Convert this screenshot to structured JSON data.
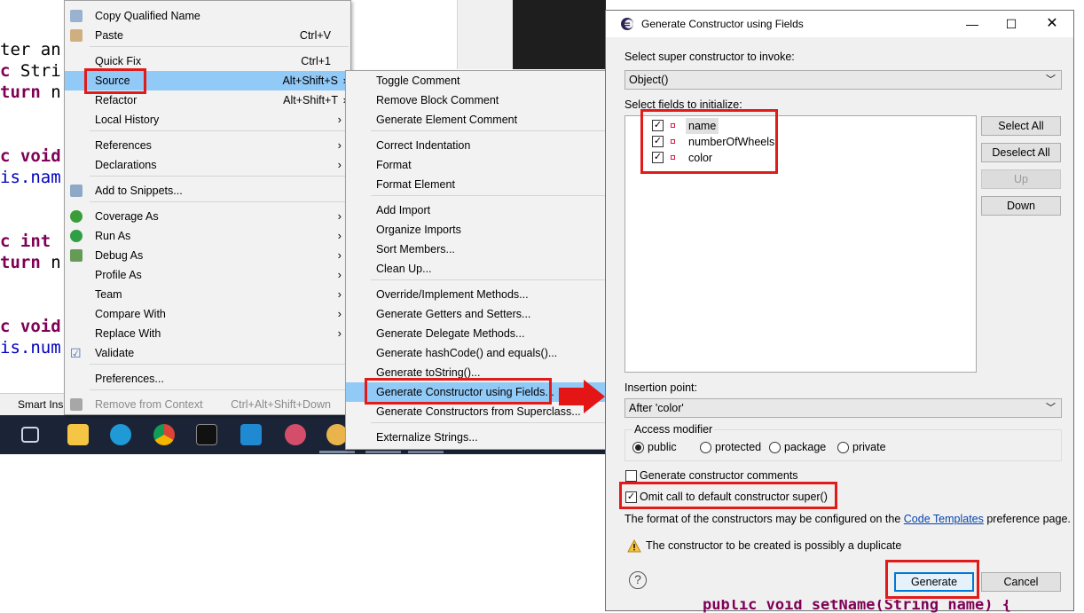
{
  "editor": {
    "lines": [
      {
        "pre": "ter an",
        "kw": "",
        "post": ""
      },
      {
        "pre": "",
        "kw": "c",
        "post": " Stri"
      },
      {
        "pre": "",
        "kw": "turn",
        "post": " n"
      },
      {
        "pre": "",
        "kw": "c void",
        "post": ""
      },
      {
        "pre": "",
        "kw": "",
        "post": "is.nam"
      },
      {
        "pre": "",
        "kw": "c int",
        "post": ""
      },
      {
        "pre": "",
        "kw": "turn",
        "post": " n"
      },
      {
        "pre": "",
        "kw": "c void",
        "post": ""
      },
      {
        "pre": "",
        "kw": "",
        "post": "is.num"
      }
    ],
    "status_text": "Smart Ins",
    "bottom_code": "public void setName(String name) {"
  },
  "context_menu": {
    "items": [
      {
        "label": "Copy Qualified Name",
        "shortcut": "",
        "submenu": false,
        "icon": "copy-icon"
      },
      {
        "label": "Paste",
        "shortcut": "Ctrl+V",
        "submenu": false,
        "icon": "paste-icon"
      },
      {
        "label": "Quick Fix",
        "shortcut": "Ctrl+1",
        "submenu": false,
        "icon": ""
      },
      {
        "label": "Source",
        "shortcut": "Alt+Shift+S",
        "submenu": true,
        "icon": ""
      },
      {
        "label": "Refactor",
        "shortcut": "Alt+Shift+T",
        "submenu": true,
        "icon": ""
      },
      {
        "label": "Local History",
        "shortcut": "",
        "submenu": true,
        "icon": ""
      },
      {
        "label": "References",
        "shortcut": "",
        "submenu": true,
        "icon": ""
      },
      {
        "label": "Declarations",
        "shortcut": "",
        "submenu": true,
        "icon": ""
      },
      {
        "label": "Add to Snippets...",
        "shortcut": "",
        "submenu": false,
        "icon": "snippet-icon"
      },
      {
        "label": "Coverage As",
        "shortcut": "",
        "submenu": true,
        "icon": "coverage-icon"
      },
      {
        "label": "Run As",
        "shortcut": "",
        "submenu": true,
        "icon": "run-icon"
      },
      {
        "label": "Debug As",
        "shortcut": "",
        "submenu": true,
        "icon": "debug-icon"
      },
      {
        "label": "Profile As",
        "shortcut": "",
        "submenu": true,
        "icon": ""
      },
      {
        "label": "Team",
        "shortcut": "",
        "submenu": true,
        "icon": ""
      },
      {
        "label": "Compare With",
        "shortcut": "",
        "submenu": true,
        "icon": ""
      },
      {
        "label": "Replace With",
        "shortcut": "",
        "submenu": true,
        "icon": ""
      },
      {
        "label": "Validate",
        "shortcut": "",
        "submenu": false,
        "icon": "check-icon"
      },
      {
        "label": "Preferences...",
        "shortcut": "",
        "submenu": false,
        "icon": ""
      },
      {
        "label": "Remove from Context",
        "shortcut": "Ctrl+Alt+Shift+Down",
        "submenu": false,
        "icon": "remove-icon"
      }
    ]
  },
  "source_submenu": {
    "items": [
      "Toggle Comment",
      "Remove Block Comment",
      "Generate Element Comment",
      "Correct Indentation",
      "Format",
      "Format Element",
      "Add Import",
      "Organize Imports",
      "Sort Members...",
      "Clean Up...",
      "Override/Implement Methods...",
      "Generate Getters and Setters...",
      "Generate Delegate Methods...",
      "Generate hashCode() and equals()...",
      "Generate toString()...",
      "Generate Constructor using Fields...",
      "Generate Constructors from Superclass...",
      "Externalize Strings..."
    ]
  },
  "dialog": {
    "title": "Generate Constructor using Fields",
    "super_label": "Select super constructor to invoke:",
    "super_value": "Object()",
    "fields_label": "Select fields to initialize:",
    "fields": [
      {
        "name": "name",
        "checked": true
      },
      {
        "name": "numberOfWheels",
        "checked": true
      },
      {
        "name": "color",
        "checked": true
      }
    ],
    "buttons": {
      "select_all": "Select All",
      "deselect_all": "Deselect All",
      "up": "Up",
      "down": "Down",
      "generate": "Generate",
      "cancel": "Cancel"
    },
    "insertion_label": "Insertion point:",
    "insertion_value": "After 'color'",
    "access_label": "Access modifier",
    "access_options": [
      "public",
      "protected",
      "package",
      "private"
    ],
    "access_selected": "public",
    "gen_comments_label": "Generate constructor comments",
    "gen_comments_checked": false,
    "omit_super_label": "Omit call to default constructor super()",
    "omit_super_checked": true,
    "info_prefix": "The format of the constructors may be configured on the",
    "info_link": "Code Templates",
    "info_suffix": "preference page.",
    "warning": "The constructor to be created is possibly a duplicate",
    "help_glyph": "?"
  },
  "colors": {
    "highlight": "#91c9f7",
    "annotation_red": "#e11a1a",
    "keyword": "#7f0055"
  }
}
